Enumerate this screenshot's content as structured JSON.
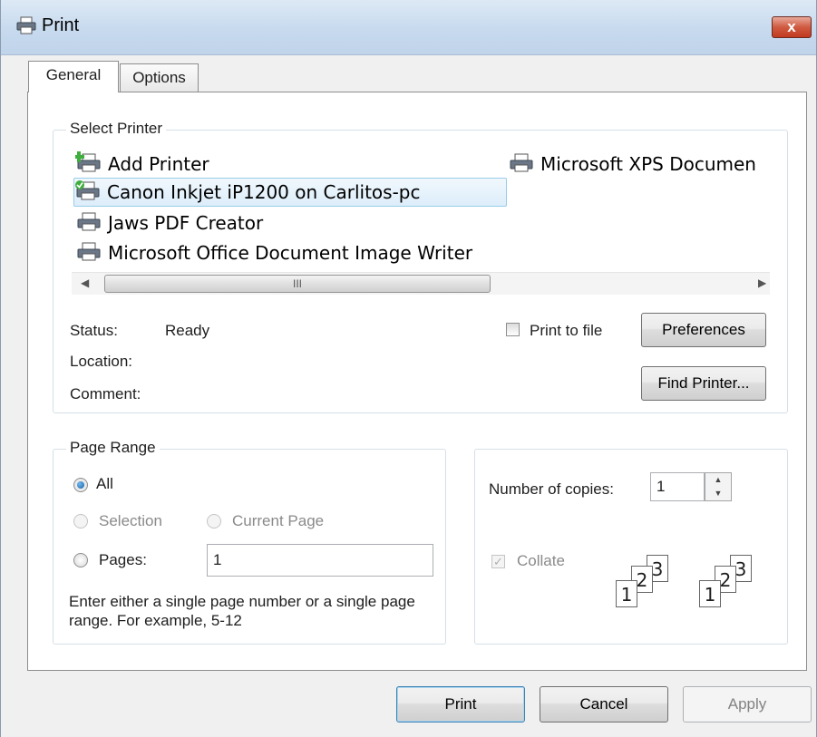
{
  "window": {
    "title": "Print",
    "close_label": "x"
  },
  "tabs": [
    {
      "label": "General"
    },
    {
      "label": "Options"
    }
  ],
  "select_printer": {
    "legend": "Select Printer",
    "printers": [
      {
        "label": "Add Printer"
      },
      {
        "label": "Microsoft XPS Documen"
      },
      {
        "label": "Canon Inkjet iP1200 on Carlitos-pc",
        "selected": true
      },
      {
        "label": "Jaws PDF Creator"
      },
      {
        "label": "Microsoft Office Document Image Writer"
      }
    ],
    "scroll_thumb_label": "III",
    "status_label": "Status:",
    "status_value": "Ready",
    "location_label": "Location:",
    "comment_label": "Comment:",
    "print_to_file_label": "Print to file",
    "preferences_button": "Preferences",
    "find_printer_button": "Find Printer..."
  },
  "page_range": {
    "legend": "Page Range",
    "all_label": "All",
    "selection_label": "Selection",
    "current_page_label": "Current Page",
    "pages_label": "Pages:",
    "pages_value": "1",
    "hint": "Enter either a single page number or a single page range.  For example, 5-12"
  },
  "copies": {
    "label": "Number of copies:",
    "value": "1",
    "collate_label": "Collate",
    "collate_pages": [
      "1",
      "2",
      "3"
    ]
  },
  "footer": {
    "print_button": "Print",
    "cancel_button": "Cancel",
    "apply_button": "Apply"
  }
}
